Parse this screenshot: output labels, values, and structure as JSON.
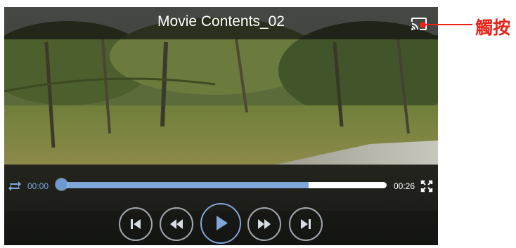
{
  "player": {
    "title": "Movie Contents_02",
    "current_time": "00:00",
    "total_time": "00:26",
    "progress_fraction": 0.76,
    "icons": {
      "cast": "cast-icon",
      "repeat": "repeat-icon",
      "fullscreen": "fullscreen-icon",
      "previous": "skip-previous-icon",
      "rewind": "rewind-icon",
      "play": "play-icon",
      "fast_forward": "fast-forward-icon",
      "next": "skip-next-icon"
    },
    "colors": {
      "accent": "#7fa6d8",
      "annotation": "#e8231a"
    }
  },
  "annotation": {
    "label": "觸按"
  }
}
